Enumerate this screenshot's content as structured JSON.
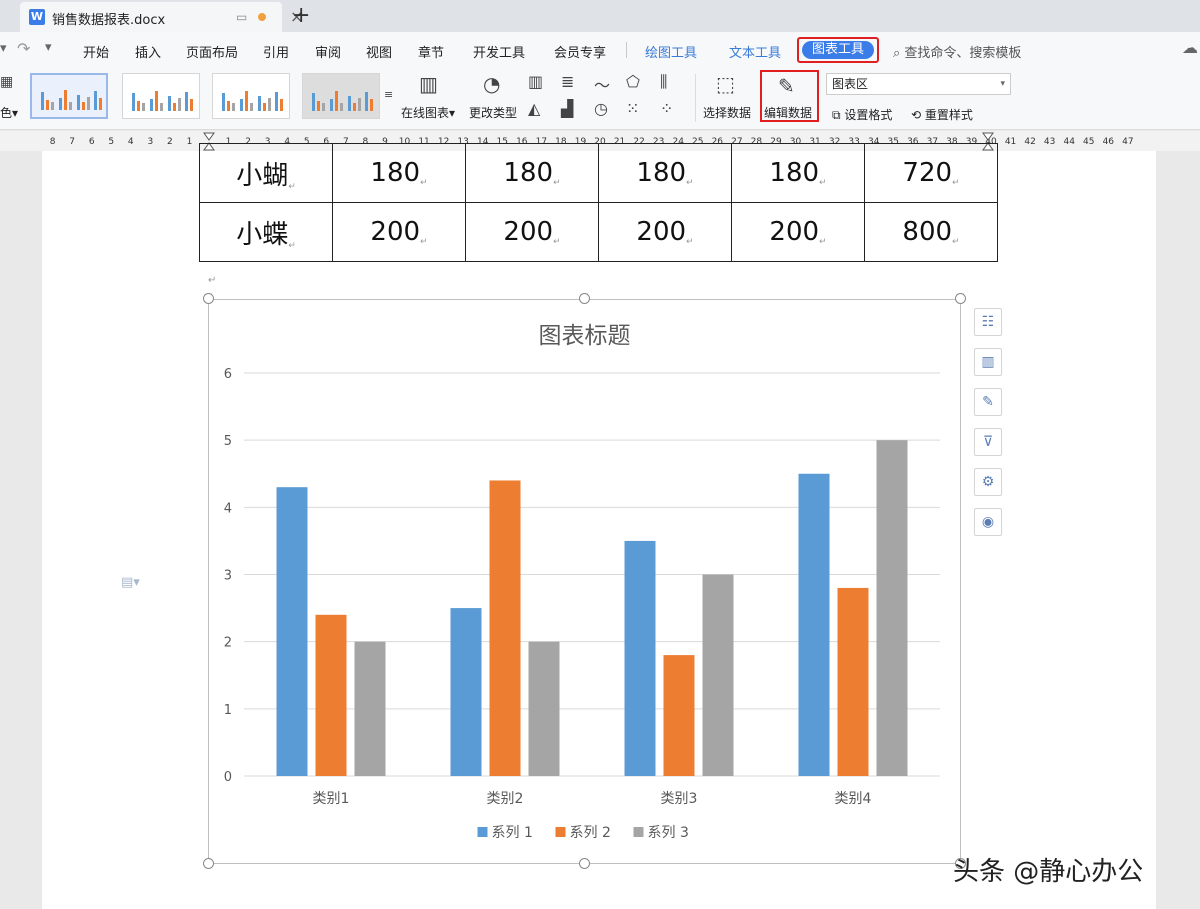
{
  "titlebar": {
    "doc_title": "销售数据报表.docx",
    "new_tab_symbol": "+"
  },
  "menubar": {
    "items": [
      "开始",
      "插入",
      "页面布局",
      "引用",
      "审阅",
      "视图",
      "章节",
      "开发工具",
      "会员专享"
    ],
    "context_tabs": [
      "绘图工具",
      "文本工具"
    ],
    "active_context_tab": "图表工具",
    "search_placeholder": "查找命令、搜索模板"
  },
  "ribbon": {
    "left_partial_label": "色",
    "online_chart": "在线图表",
    "change_type": "更改类型",
    "select_data": "选择数据",
    "edit_data": "编辑数据",
    "chart_area_value": "图表区",
    "set_format": "设置格式",
    "reset_style": "重置样式"
  },
  "table": {
    "rows": [
      {
        "name": "小蝴",
        "values": [
          "180",
          "180",
          "180",
          "180",
          "720"
        ]
      },
      {
        "name": "小蝶",
        "values": [
          "200",
          "200",
          "200",
          "200",
          "800"
        ]
      }
    ]
  },
  "chart_data": {
    "type": "bar",
    "title": "图表标题",
    "categories": [
      "类别1",
      "类别2",
      "类别3",
      "类别4"
    ],
    "series": [
      {
        "name": "系列 1",
        "color": "#5b9bd5",
        "values": [
          4.3,
          2.5,
          3.5,
          4.5
        ]
      },
      {
        "name": "系列 2",
        "color": "#ed7d31",
        "values": [
          2.4,
          4.4,
          1.8,
          2.8
        ]
      },
      {
        "name": "系列 3",
        "color": "#a5a5a5",
        "values": [
          2,
          2,
          3,
          5
        ]
      }
    ],
    "ylim": [
      0,
      6
    ],
    "yticks": [
      "0",
      "1",
      "2",
      "3",
      "4",
      "5",
      "6"
    ],
    "grid": true,
    "legend_position": "bottom"
  },
  "side_tools": [
    "chart-elements-icon",
    "chart-style-icon",
    "brush-icon",
    "filter-icon",
    "settings-icon",
    "idea-icon"
  ],
  "watermark": "头条 @静心办公"
}
